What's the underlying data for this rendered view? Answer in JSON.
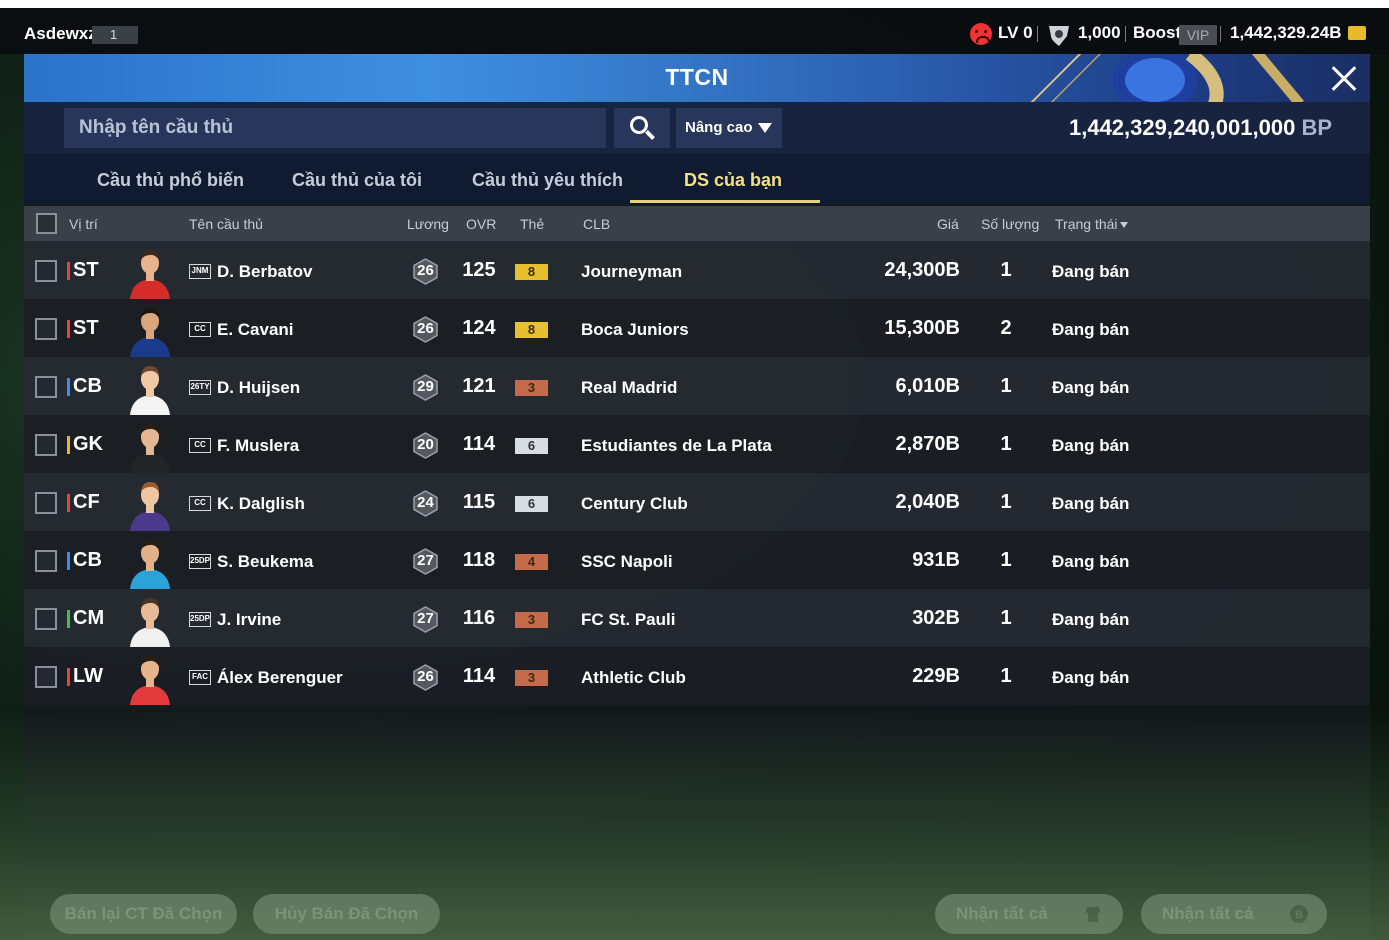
{
  "topbar": {
    "username": "Asdewxz",
    "user_badge": "1",
    "level": "LV 0",
    "currency_amount": "1,000",
    "boost_label": "Boost",
    "vip_label": "VIP",
    "balance": "1,442,329.24B"
  },
  "window": {
    "title": "TTCN",
    "search_placeholder": "Nhập tên cầu thủ",
    "advanced_label": "Nâng cao",
    "bp_amount": "1,442,329,240,001,000",
    "bp_unit": "BP"
  },
  "tabs": [
    {
      "label": "Cầu thủ phổ biến"
    },
    {
      "label": "Cầu thủ của tôi"
    },
    {
      "label": "Cầu thủ yêu thích"
    },
    {
      "label": "DS của bạn"
    }
  ],
  "columns": {
    "position": "Vị trí",
    "name": "Tên cầu thủ",
    "salary": "Lương",
    "ovr": "OVR",
    "grade": "Thẻ",
    "club": "CLB",
    "price": "Giá",
    "quantity": "Số lượng",
    "status": "Trạng thái"
  },
  "colors": {
    "ST": "#e8433a",
    "LW": "#e8433a",
    "CF": "#e8433a",
    "CB": "#3a8df0",
    "CM": "#3fbf54",
    "GK": "#e8b430",
    "grade_gold": "#e7c02e",
    "grade_bronze": "#c66a4c",
    "grade_silver": "#d8dde3"
  },
  "rows": [
    {
      "position": "ST",
      "season": "JNM",
      "name": "D. Berbatov",
      "salary": "26",
      "ovr": "125",
      "grade": "8",
      "grade_color": "#e7c02e",
      "club": "Journeyman",
      "price": "24,300B",
      "qty": "1",
      "status": "Đang bán",
      "kit": "#d62b2b",
      "skin": "#e7b48d",
      "hair": "#3b2a1c"
    },
    {
      "position": "ST",
      "season": "CC",
      "name": "E. Cavani",
      "salary": "26",
      "ovr": "124",
      "grade": "8",
      "grade_color": "#e7c02e",
      "club": "Boca Juniors",
      "price": "15,300B",
      "qty": "2",
      "status": "Đang bán",
      "kit": "#1c3a8c",
      "skin": "#d9a57d",
      "hair": "#1b1410"
    },
    {
      "position": "CB",
      "season": "26TY",
      "name": "D. Huijsen",
      "salary": "29",
      "ovr": "121",
      "grade": "3",
      "grade_color": "#c66a4c",
      "club": "Real Madrid",
      "price": "6,010B",
      "qty": "1",
      "status": "Đang bán",
      "kit": "#f4f4f4",
      "skin": "#f0c9a4",
      "hair": "#6b4a2f"
    },
    {
      "position": "GK",
      "season": "CC",
      "name": "F. Muslera",
      "salary": "20",
      "ovr": "114",
      "grade": "6",
      "grade_color": "#d8dde3",
      "club": "Estudiantes de La Plata",
      "price": "2,870B",
      "qty": "1",
      "status": "Đang bán",
      "kit": "#222427",
      "skin": "#e4b792",
      "hair": "#2a1d14"
    },
    {
      "position": "CF",
      "season": "CC",
      "name": "K. Dalglish",
      "salary": "24",
      "ovr": "115",
      "grade": "6",
      "grade_color": "#d8dde3",
      "club": "Century Club",
      "price": "2,040B",
      "qty": "1",
      "status": "Đang bán",
      "kit": "#4b3a8c",
      "skin": "#efc6a2",
      "hair": "#9a5b2e"
    },
    {
      "position": "CB",
      "season": "25DP",
      "name": "S. Beukema",
      "salary": "27",
      "ovr": "118",
      "grade": "4",
      "grade_color": "#c66a4c",
      "club": "SSC Napoli",
      "price": "931B",
      "qty": "1",
      "status": "Đang bán",
      "kit": "#2aa3d8",
      "skin": "#e2b08a",
      "hair": "#2a1d14"
    },
    {
      "position": "CM",
      "season": "25DP",
      "name": "J. Irvine",
      "salary": "27",
      "ovr": "116",
      "grade": "3",
      "grade_color": "#c66a4c",
      "club": "FC St. Pauli",
      "price": "302B",
      "qty": "1",
      "status": "Đang bán",
      "kit": "#f1f1f1",
      "skin": "#e8bb96",
      "hair": "#4a3524"
    },
    {
      "position": "LW",
      "season": "FAC",
      "name": "Álex Berenguer",
      "salary": "26",
      "ovr": "114",
      "grade": "3",
      "grade_color": "#c66a4c",
      "club": "Athletic Club",
      "price": "229B",
      "qty": "1",
      "status": "Đang bán",
      "kit": "#e33b3b",
      "skin": "#e6b38c",
      "hair": "#2a1d14"
    }
  ],
  "footer": {
    "resell_label": "Bán lại CT Đã Chọn",
    "cancel_label": "Hủy Bán Đã Chọn",
    "claim_all_label_1": "Nhận tất cả",
    "claim_all_label_2": "Nhận tất cả"
  }
}
